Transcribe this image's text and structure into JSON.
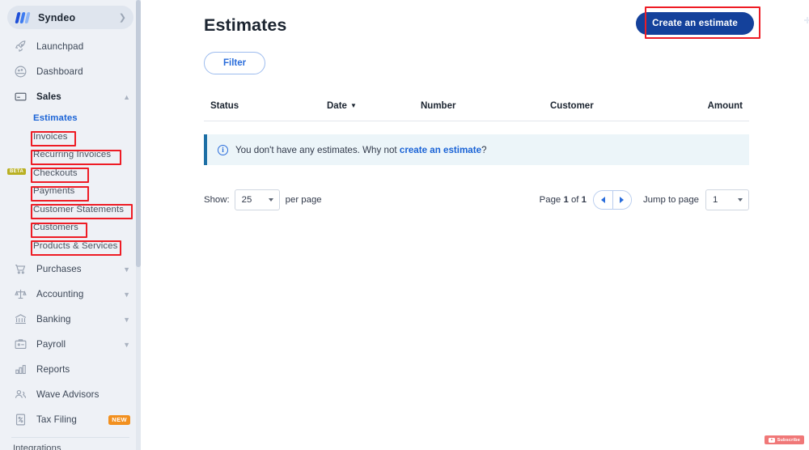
{
  "brand": {
    "name": "Syndeo",
    "chevron": "chevron-right-icon"
  },
  "sidebar": {
    "items": [
      {
        "label": "Launchpad",
        "icon": "rocket-icon"
      },
      {
        "label": "Dashboard",
        "icon": "dashboard-icon"
      },
      {
        "label": "Sales",
        "icon": "card-icon",
        "expanded": true
      },
      {
        "label": "Purchases",
        "icon": "cart-icon"
      },
      {
        "label": "Accounting",
        "icon": "scales-icon"
      },
      {
        "label": "Banking",
        "icon": "bank-icon"
      },
      {
        "label": "Payroll",
        "icon": "payroll-id-icon"
      },
      {
        "label": "Reports",
        "icon": "bar-chart-icon"
      },
      {
        "label": "Wave Advisors",
        "icon": "people-icon"
      },
      {
        "label": "Tax Filing",
        "icon": "percent-doc-icon",
        "badge": "NEW"
      }
    ],
    "sales_sub_items": [
      {
        "label": "Estimates",
        "current": true
      },
      {
        "label": "Invoices"
      },
      {
        "label": "Recurring Invoices"
      },
      {
        "label": "Checkouts",
        "badge": "BETA"
      },
      {
        "label": "Payments"
      },
      {
        "label": "Customer Statements"
      },
      {
        "label": "Customers"
      },
      {
        "label": "Products & Services"
      }
    ],
    "footer_label": "Integrations"
  },
  "header": {
    "title": "Estimates",
    "create_button": "Create an estimate",
    "filter_button": "Filter"
  },
  "table": {
    "columns": [
      "Status",
      "Date",
      "Number",
      "Customer",
      "Amount"
    ],
    "sorted_column": "Date",
    "rows": []
  },
  "empty_state": {
    "icon": "info-circle-icon",
    "text_before": "You don't have any estimates. Why not ",
    "link": "create an estimate",
    "text_after": "?"
  },
  "pagination": {
    "show_label": "Show:",
    "page_size": "25",
    "per_page_label": "per page",
    "page_status_prefix": "Page ",
    "current_page": "1",
    "of_label": " of ",
    "total_pages": "1",
    "prev_icon": "chevron-left-icon",
    "next_icon": "chevron-right-icon",
    "jump_label": "Jump to page",
    "jump_value": "1"
  },
  "overlay": {
    "subscribe_label": "Subscribe",
    "icon": "youtube-icon"
  },
  "colors": {
    "sidebar_bg": "#eef1f6",
    "primary_blue": "#14419b",
    "link_blue": "#1a63d6",
    "highlight_red": "#ee1c25",
    "banner_bg": "#ecf5f9",
    "banner_accent": "#1d6fa5",
    "badge_new": "#f2901f",
    "badge_beta": "#b9b023"
  }
}
